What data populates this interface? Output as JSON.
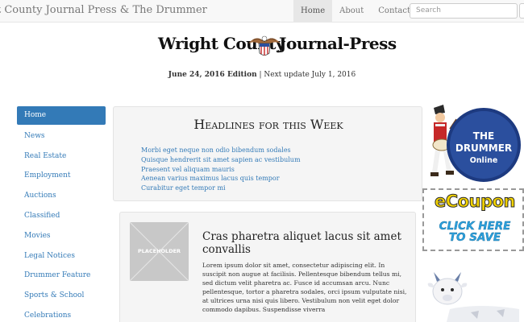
{
  "navbar": {
    "brand": "t County Journal Press & The Drummer",
    "links": [
      "Home",
      "About",
      "Contact"
    ],
    "search_placeholder": "Search"
  },
  "masthead": {
    "title_left": "Wright County",
    "title_right": "Journal-Press",
    "edition_bold": "June 24, 2016 Edition",
    "edition_rest": " | Next update July 1, 2016"
  },
  "sidebar": {
    "items": [
      "Home",
      "News",
      "Real Estate",
      "Employment",
      "Auctions",
      "Classified",
      "Movies",
      "Legal Notices",
      "Drummer Feature",
      "Sports & School",
      "Celebrations"
    ]
  },
  "headlines": {
    "title": "Headlines for this Week",
    "links": [
      "Morbi eget neque non odio bibendum sodales",
      "Quisque hendrerit sit amet sapien ac vestibulum",
      "Praesent vel aliquam mauris",
      "Aenean varius maximus lacus quis tempor",
      "Curabitur eget tempor mi"
    ]
  },
  "article": {
    "placeholder": "PLACEHOLDER",
    "title": "Cras pharetra aliquet lacus sit amet convallis",
    "body": "Lorem ipsum dolor sit amet, consectetur adipiscing elit. In suscipit non augue at facilisis. Pellentesque bibendum tellus mi, sed dictum velit pharetra ac. Fusce id accumsan arcu. Nunc pellentesque, tortor a pharetra sodales, orci ipsum vulputate nisi, at ultrices urna nisi quis libero. Vestibulum non velit eget dolor commodo dapibus. Suspendisse viverra"
  },
  "ads": {
    "drummer_line1": "THE",
    "drummer_line2": "DRUMMER",
    "drummer_line3": "Online",
    "coupon_title": "eCoupon",
    "coupon_cta_line1": "CLICK HERE",
    "coupon_cta_line2": "TO SAVE"
  },
  "colors": {
    "link": "#337ab7",
    "drummer_blue": "#2b4f9e",
    "coupon_yellow": "#f2d200",
    "coupon_cta": "#2ba0dd"
  }
}
